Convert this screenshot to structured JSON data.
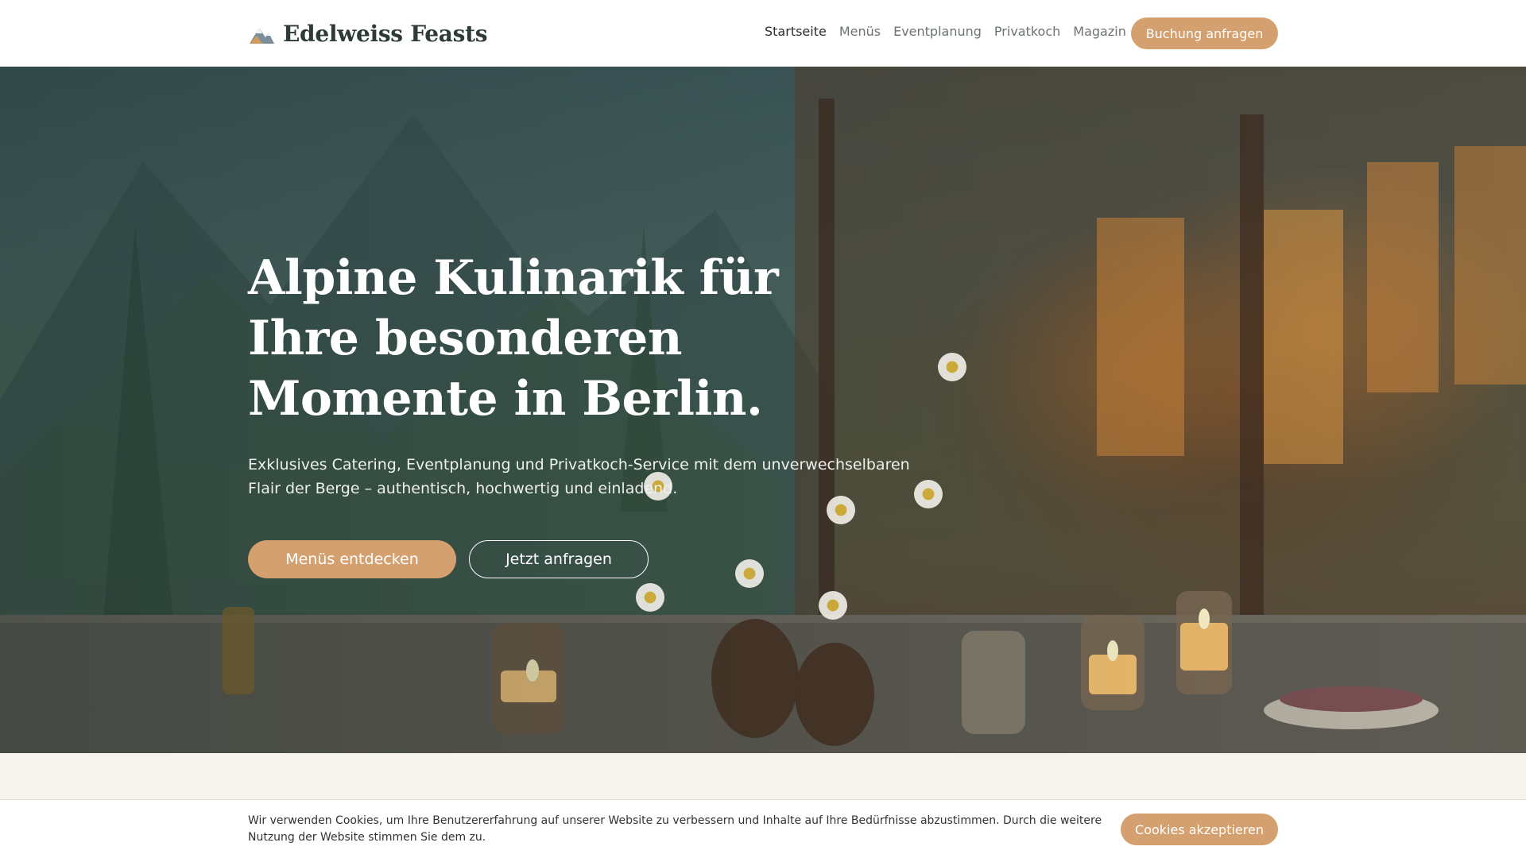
{
  "header": {
    "brand_name": "Edelweiss Feasts",
    "logo_icon": "mountain-logo-icon",
    "nav": [
      {
        "label": "Startseite",
        "active": true
      },
      {
        "label": "Menüs",
        "active": false
      },
      {
        "label": "Eventplanung",
        "active": false
      },
      {
        "label": "Privatkoch",
        "active": false
      },
      {
        "label": "Magazin",
        "active": false
      }
    ],
    "cta_label": "Buchung anfragen"
  },
  "hero": {
    "title": "Alpine Kulinarik für Ihre besonderen Momente in Berlin.",
    "subtitle": "Exklusives Catering, Eventplanung und Privatkoch-Service mit dem unverwechselbaren Flair der Berge – authentisch, hochwertig und einladend.",
    "primary_button": "Menüs entdecken",
    "secondary_button": "Jetzt anfragen"
  },
  "cookie_banner": {
    "text": "Wir verwenden Cookies, um Ihre Benutzererfahrung auf unserer Website zu verbessern und Inhalte auf Ihre Bedürfnisse abzustimmen. Durch die weitere Nutzung der Website stimmen Sie dem zu.",
    "button": "Cookies akzeptieren"
  },
  "colors": {
    "accent": "#d4a06f",
    "brand_text": "#2e3a36",
    "nav_text": "#6b7470",
    "background": "#f7f4ee"
  }
}
